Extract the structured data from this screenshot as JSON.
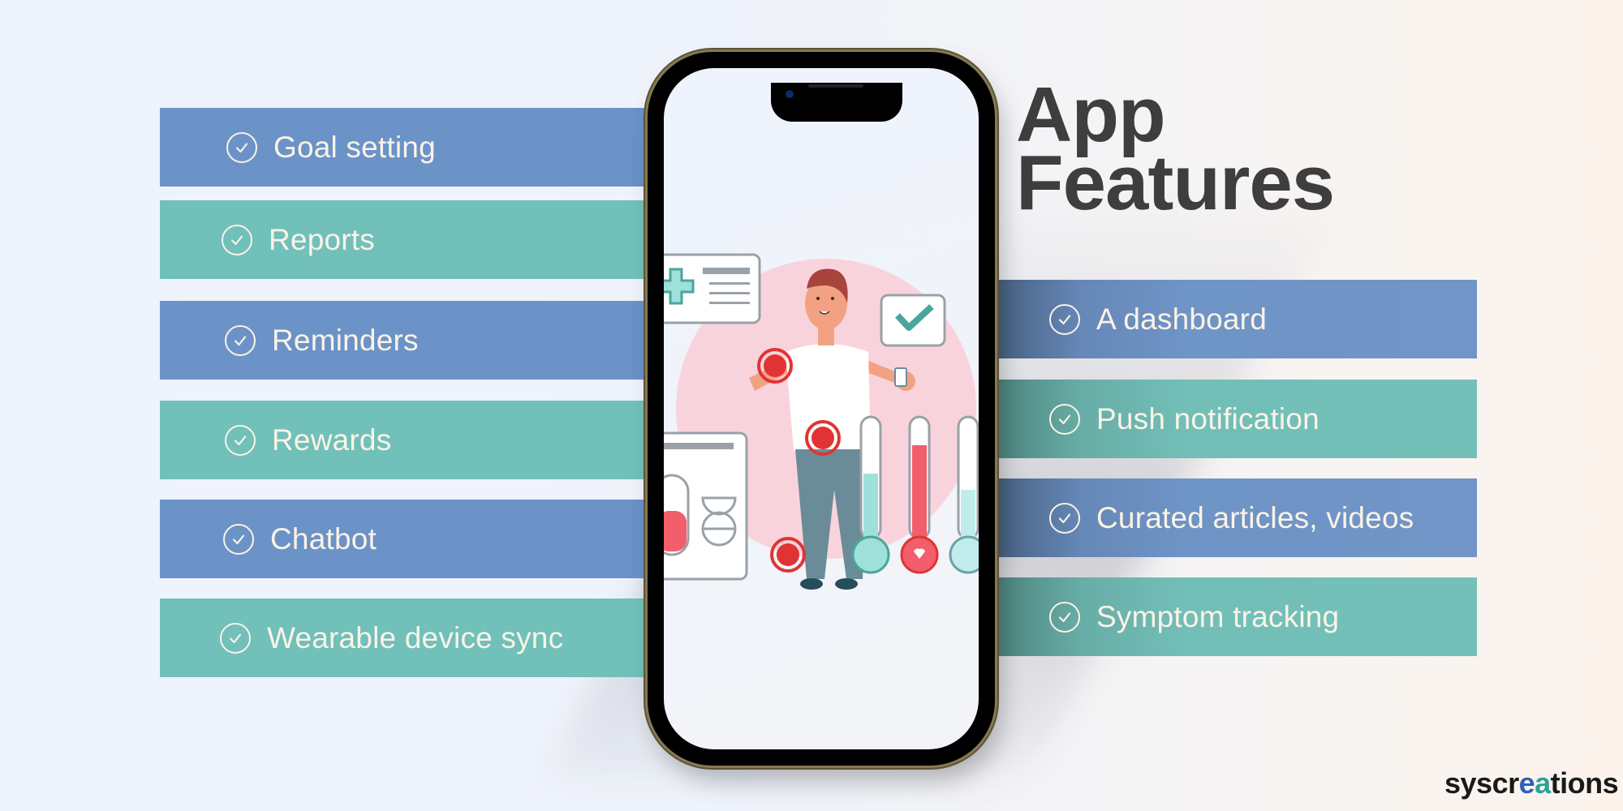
{
  "title": {
    "line1": "App",
    "line2": "Features"
  },
  "left_features": [
    {
      "label": "Goal setting",
      "color": "blue"
    },
    {
      "label": "Reports",
      "color": "teal"
    },
    {
      "label": "Reminders",
      "color": "blue"
    },
    {
      "label": "Rewards",
      "color": "teal"
    },
    {
      "label": "Chatbot",
      "color": "blue"
    },
    {
      "label": "Wearable device sync",
      "color": "teal"
    }
  ],
  "right_features": [
    {
      "label": "A dashboard",
      "color": "blue"
    },
    {
      "label": "Push notification",
      "color": "teal"
    },
    {
      "label": "Curated articles, videos",
      "color": "blue"
    },
    {
      "label": "Symptom tracking",
      "color": "teal"
    }
  ],
  "icons": {
    "feature_bullet": "check-circle-icon"
  },
  "brand": {
    "prefix": "syscr",
    "mid_b": "e",
    "mid_t": "a",
    "suffix": "tions"
  },
  "colors": {
    "blue": "#6b93c8",
    "teal": "#71c0ba",
    "text_light": "#fbf3e6",
    "title": "#3e3e3e",
    "phone_frame": "#857a55"
  }
}
